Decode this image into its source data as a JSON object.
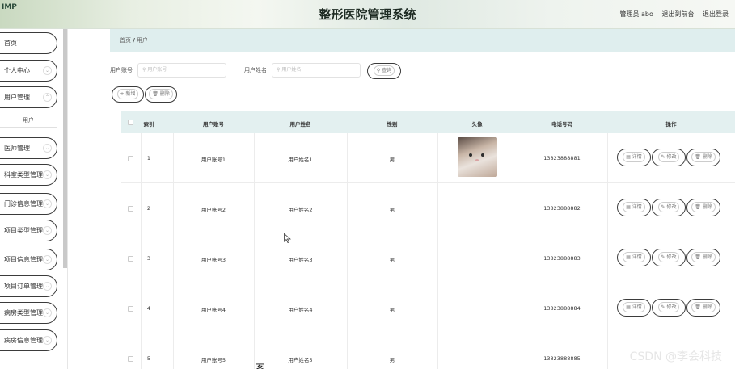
{
  "header": {
    "logo": "IMP",
    "title": "整形医院管理系统",
    "user_label": "管理员 abo",
    "back_to_front": "退出到前台",
    "logout": "退出登录"
  },
  "sidebar": {
    "items": [
      {
        "label": "首页"
      },
      {
        "label": "个人中心"
      },
      {
        "label": "用户管理"
      },
      {
        "label": "医师管理"
      },
      {
        "label": "科室类型管理"
      },
      {
        "label": "门诊信息管理"
      },
      {
        "label": "项目类型管理"
      },
      {
        "label": "项目信息管理"
      },
      {
        "label": "项目订单管理"
      },
      {
        "label": "病房类型管理"
      },
      {
        "label": "病房信息管理"
      }
    ],
    "active_submenu": "用户"
  },
  "breadcrumb": {
    "home": "首页",
    "separator": "/",
    "current": "用户"
  },
  "search": {
    "account_label": "用户账号",
    "account_placeholder": "用户账号",
    "name_label": "用户姓名",
    "name_placeholder": "用户姓名",
    "query_button": "查询"
  },
  "actions": {
    "add": "新增",
    "delete": "删除"
  },
  "table": {
    "headers": [
      "索引",
      "用户账号",
      "用户姓名",
      "性别",
      "头像",
      "电话号码",
      "操作"
    ],
    "rows": [
      {
        "index": "1",
        "account": "用户账号1",
        "name": "用户姓名1",
        "gender": "男",
        "phone": "13823888881"
      },
      {
        "index": "2",
        "account": "用户账号2",
        "name": "用户姓名2",
        "gender": "男",
        "phone": "13823888882"
      },
      {
        "index": "3",
        "account": "用户账号3",
        "name": "用户姓名3",
        "gender": "男",
        "phone": "13823888883"
      },
      {
        "index": "4",
        "account": "用户账号4",
        "name": "用户姓名4",
        "gender": "男",
        "phone": "13823888884"
      },
      {
        "index": "5",
        "account": "用户账号5",
        "name": "用户姓名5",
        "gender": "男",
        "phone": "13823888885"
      }
    ],
    "row_buttons": {
      "detail": "详情",
      "edit": "修改",
      "delete": "删除"
    }
  },
  "watermark": "CSDN @李会科技",
  "caption": "图"
}
